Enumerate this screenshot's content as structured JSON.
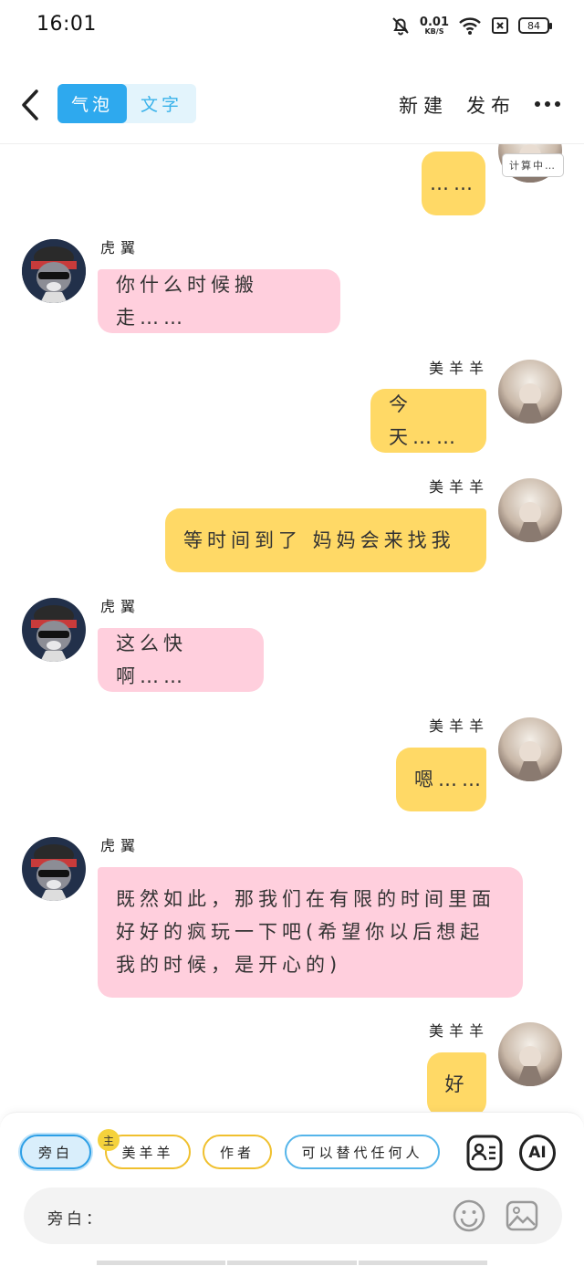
{
  "status_bar": {
    "time": "16:01",
    "net_speed": "0.01",
    "net_unit": "KB/S",
    "battery": "84"
  },
  "header": {
    "tab_bubble": "气泡",
    "tab_text": "文字",
    "new_label": "新建",
    "publish_label": "发布"
  },
  "chat": {
    "calculating": "计算中…",
    "messages": [
      {
        "sender": "",
        "side": "right",
        "text": "……"
      },
      {
        "sender": "虎翼",
        "side": "left",
        "text": "你什么时候搬走……"
      },
      {
        "sender": "美羊羊",
        "side": "right",
        "text": "今天……"
      },
      {
        "sender": "美羊羊",
        "side": "right",
        "text": "等时间到了 妈妈会来找我"
      },
      {
        "sender": "虎翼",
        "side": "left",
        "text": "这么快啊……"
      },
      {
        "sender": "美羊羊",
        "side": "right",
        "text": "嗯……"
      },
      {
        "sender": "虎翼",
        "side": "left",
        "text": "既然如此，那我们在有限的时间里面好好的疯玩一下吧(希望你以后想起我的时候，是开心的)"
      },
      {
        "sender": "美羊羊",
        "side": "right",
        "text": "好"
      }
    ]
  },
  "bottom": {
    "chips": [
      "旁白",
      "美羊羊",
      "作者",
      "可以替代任何人"
    ],
    "owner_badge": "主",
    "ai_label": "AI",
    "input_label": "旁白："
  },
  "colors": {
    "accent": "#2ea9ee",
    "left_bubble": "#ffcfdd",
    "right_bubble": "#ffd966"
  }
}
